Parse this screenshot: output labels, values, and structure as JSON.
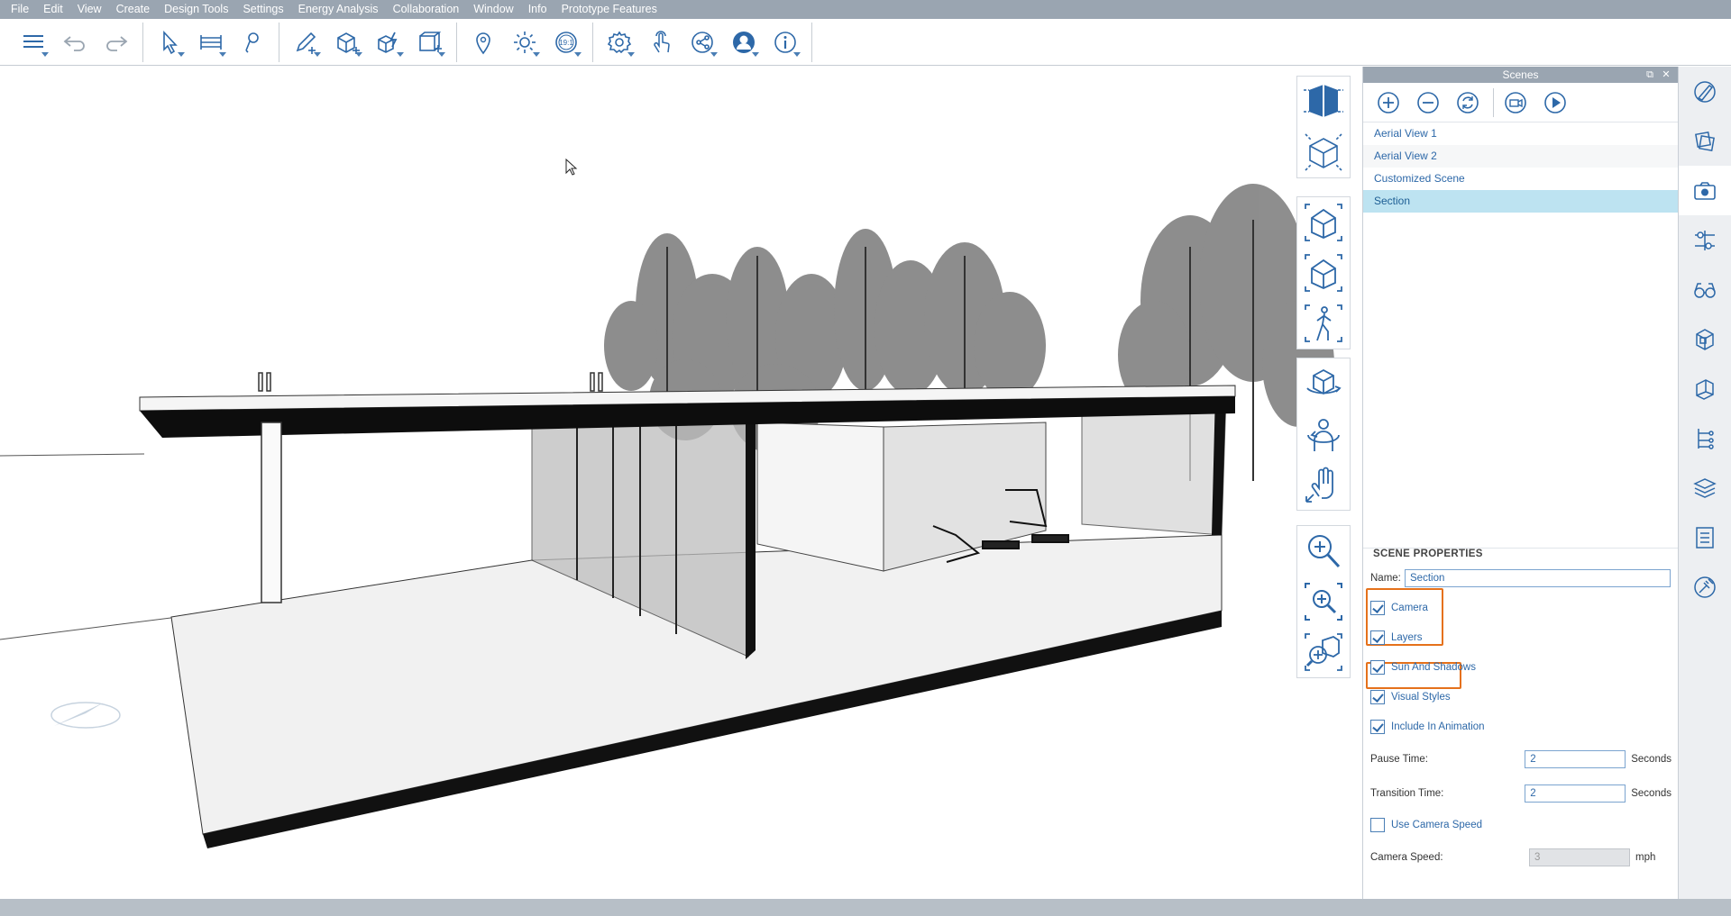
{
  "menu": [
    "File",
    "Edit",
    "View",
    "Create",
    "Design Tools",
    "Settings",
    "Energy Analysis",
    "Collaboration",
    "Window",
    "Info",
    "Prototype Features"
  ],
  "toolbar": {
    "groups": [
      [
        {
          "icon": "list-menu-icon",
          "drop": true
        },
        {
          "icon": "undo-icon",
          "drop": false
        },
        {
          "icon": "redo-icon",
          "drop": false
        }
      ],
      [
        {
          "icon": "select-arrow-icon",
          "drop": true
        },
        {
          "icon": "measure-icon",
          "drop": true
        },
        {
          "icon": "paint-bucket-icon",
          "drop": false
        }
      ],
      [
        {
          "icon": "sketch-pencil-icon",
          "drop": true
        },
        {
          "icon": "push-pull-box-icon",
          "drop": true
        },
        {
          "icon": "modify-shape-icon",
          "drop": true
        },
        {
          "icon": "component-icon",
          "drop": true
        }
      ],
      [
        {
          "icon": "location-pin-icon",
          "drop": false
        },
        {
          "icon": "sun-icon",
          "drop": true
        },
        {
          "icon": "scale-icon",
          "drop": true
        }
      ],
      [
        {
          "icon": "gear-icon",
          "drop": true
        },
        {
          "icon": "touch-hand-icon",
          "drop": false
        },
        {
          "icon": "share-icon",
          "drop": true
        },
        {
          "icon": "user-icon",
          "drop": true
        },
        {
          "icon": "info-icon",
          "drop": true
        }
      ]
    ]
  },
  "scenes_panel": {
    "title": "Scenes",
    "toolbar_icons": [
      "add-scene-icon",
      "remove-scene-icon",
      "update-scene-icon",
      "record-scene-icon",
      "play-icon"
    ],
    "scenes": [
      {
        "label": "Aerial View 1",
        "selected": false
      },
      {
        "label": "Aerial View 2",
        "selected": false
      },
      {
        "label": "Customized Scene",
        "selected": false
      },
      {
        "label": "Section",
        "selected": true
      }
    ],
    "properties": {
      "heading": "SCENE PROPERTIES",
      "name_label": "Name:",
      "name_value": "Section",
      "checkboxes": {
        "camera": {
          "label": "Camera",
          "checked": true
        },
        "layers": {
          "label": "Layers",
          "checked": true
        },
        "sun": {
          "label": "Sun And Shadows",
          "checked": true
        },
        "visual_styles": {
          "label": "Visual Styles",
          "checked": true
        },
        "animation": {
          "label": "Include In Animation",
          "checked": true
        },
        "camera_speed_toggle": {
          "label": "Use Camera Speed",
          "checked": false
        }
      },
      "pause_label": "Pause Time:",
      "pause_value": "2",
      "pause_unit": "Seconds",
      "transition_label": "Transition Time:",
      "transition_value": "2",
      "transition_unit": "Seconds",
      "speed_label": "Camera Speed:",
      "speed_value": "3",
      "speed_unit": "mph"
    }
  },
  "colors": {
    "accent": "#2d68a8",
    "highlight": "#e5711b",
    "selection": "#bde3f1",
    "chrome": "#9aa5b1"
  }
}
